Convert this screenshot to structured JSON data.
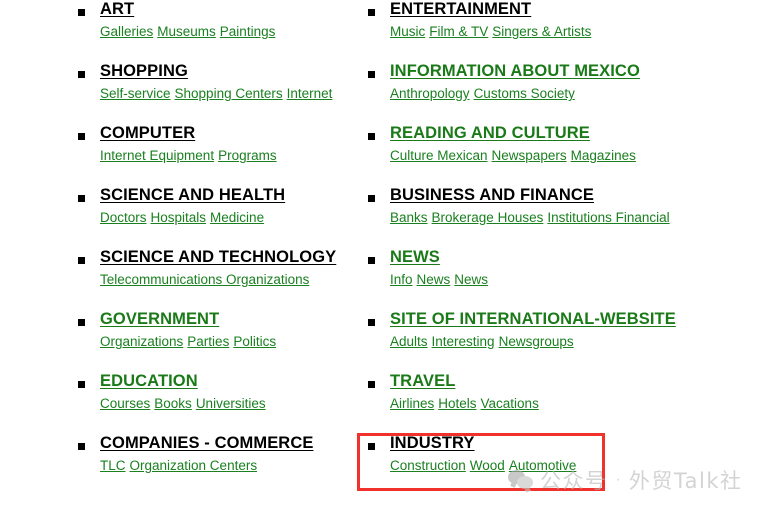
{
  "page": {
    "background_color": "#ffffff",
    "heading_black": "#000000",
    "heading_green": "#1a7a18",
    "link_green": "#1a8020",
    "highlight_color": "#f0312c"
  },
  "bullet_icon": "black-square-bullet",
  "columns": {
    "left": [
      {
        "title": "ART",
        "color": "black",
        "links": [
          "Galleries",
          "Museums",
          "Paintings"
        ]
      },
      {
        "title": "SHOPPING",
        "color": "black",
        "links": [
          "Self-service",
          "Shopping Centers",
          "Internet"
        ]
      },
      {
        "title": "COMPUTER",
        "color": "black",
        "links": [
          "Internet Equipment",
          "Programs"
        ]
      },
      {
        "title": "SCIENCE AND HEALTH",
        "color": "black",
        "links": [
          "Doctors",
          "Hospitals",
          "Medicine"
        ]
      },
      {
        "title": "SCIENCE AND TECHNOLOGY",
        "color": "black",
        "links": [
          "Telecommunications Organizations"
        ]
      },
      {
        "title": "GOVERNMENT",
        "color": "green",
        "links": [
          "Organizations",
          "Parties",
          "Politics"
        ]
      },
      {
        "title": "EDUCATION",
        "color": "green",
        "links": [
          "Courses",
          "Books",
          "Universities"
        ]
      },
      {
        "title": "COMPANIES - COMMERCE",
        "color": "black",
        "links": [
          "TLC",
          "Organization Centers"
        ]
      }
    ],
    "right": [
      {
        "title": "ENTERTAINMENT",
        "color": "black",
        "links": [
          "Music",
          "Film & TV",
          "Singers & Artists"
        ]
      },
      {
        "title": "INFORMATION ABOUT MEXICO",
        "color": "green",
        "links": [
          "Anthropology",
          "Customs Society"
        ]
      },
      {
        "title": "READING AND CULTURE",
        "color": "green",
        "links": [
          "Culture Mexican",
          "Newspapers",
          "Magazines"
        ]
      },
      {
        "title": "BUSINESS AND FINANCE",
        "color": "black",
        "links": [
          "Banks",
          "Brokerage Houses",
          "Institutions Financial"
        ]
      },
      {
        "title": "NEWS",
        "color": "green",
        "links": [
          "Info",
          "News",
          "News"
        ]
      },
      {
        "title": "SITE OF INTERNATIONAL-WEBSITE",
        "color": "green",
        "links": [
          "Adults",
          "Interesting",
          "Newsgroups"
        ]
      },
      {
        "title": "TRAVEL",
        "color": "green",
        "links": [
          "Airlines",
          "Hotels",
          "Vacations"
        ]
      },
      {
        "title": "INDUSTRY",
        "color": "black",
        "links": [
          "Construction",
          "Wood",
          "Automotive"
        ]
      }
    ]
  },
  "highlight": {
    "target": "INDUSTRY",
    "border_color": "#f0312c"
  },
  "watermark": {
    "icon": "wechat-icon",
    "label": "公众号",
    "separator": "·",
    "account": "外贸Talk社"
  }
}
